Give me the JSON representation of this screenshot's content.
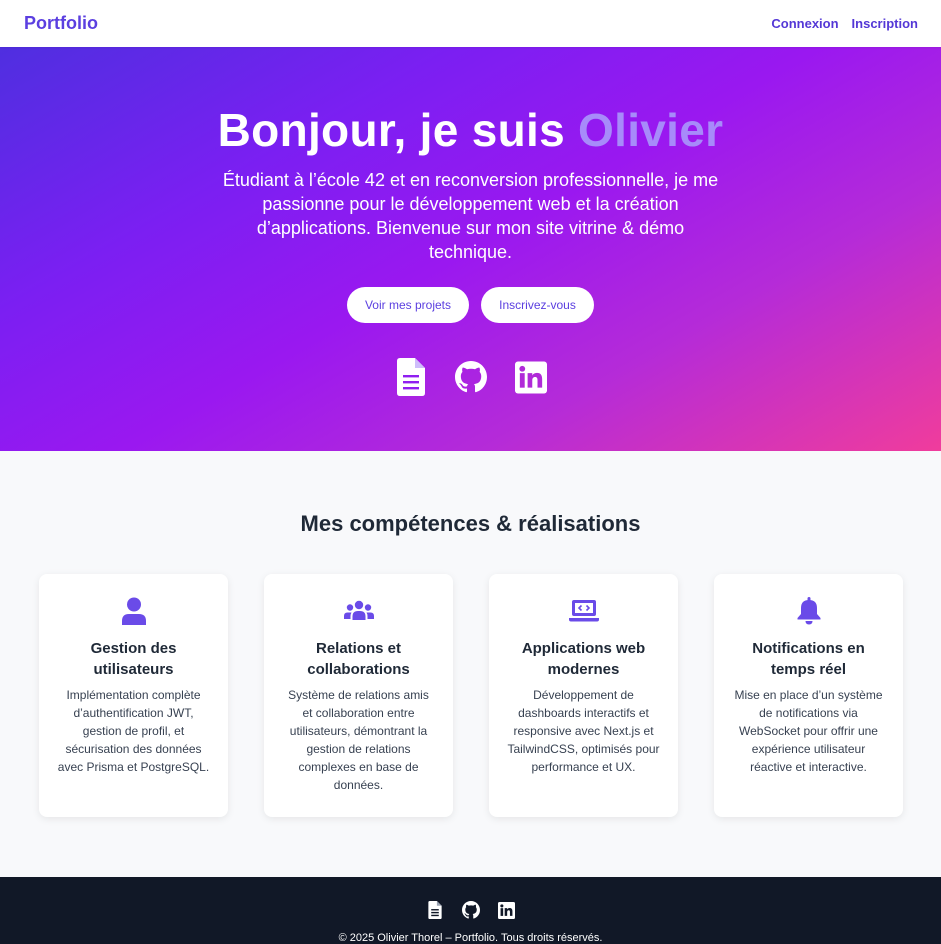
{
  "nav": {
    "brand": "Portfolio",
    "links": [
      "Connexion",
      "Inscription"
    ]
  },
  "hero": {
    "title_prefix": "Bonjour, je suis ",
    "title_name": "Olivier",
    "subtitle": "Étudiant à l’école 42 et en reconversion professionnelle, je me passionne pour le développement web et la création d’applications. Bienvenue sur mon site vitrine & démo technique.",
    "buttons": [
      "Voir mes projets",
      "Inscrivez-vous"
    ],
    "icons": [
      "document-icon",
      "github-icon",
      "linkedin-icon"
    ]
  },
  "skills": {
    "title": "Mes compétences & réalisations",
    "cards": [
      {
        "icon": "user-icon",
        "title": "Gestion des utilisateurs",
        "description": "Implémentation complète d’authentification JWT, gestion de profil, et sécurisation des données avec Prisma et PostgreSQL."
      },
      {
        "icon": "users-group-icon",
        "title": "Relations et collaborations",
        "description": "Système de relations amis et collaboration entre utilisateurs, démontrant la gestion de relations complexes en base de données."
      },
      {
        "icon": "laptop-code-icon",
        "title": "Applications web modernes",
        "description": "Développement de dashboards interactifs et responsive avec Next.js et TailwindCSS, optimisés pour performance et UX."
      },
      {
        "icon": "bell-icon",
        "title": "Notifications en temps réel",
        "description": "Mise en place d’un système de notifications via WebSocket pour offrir une expérience utilisateur réactive et interactive."
      }
    ]
  },
  "footer": {
    "icons": [
      "document-icon",
      "github-icon",
      "linkedin-icon"
    ],
    "copyright": "© 2025 Olivier Thorel – Portfolio. Tous droits réservés."
  },
  "colors": {
    "accent": "#5b3fe0",
    "title_highlight": "#a78bfa",
    "footer_bg": "#111827",
    "gradient_start": "#4f2fe0",
    "gradient_end": "#f03c9c"
  }
}
